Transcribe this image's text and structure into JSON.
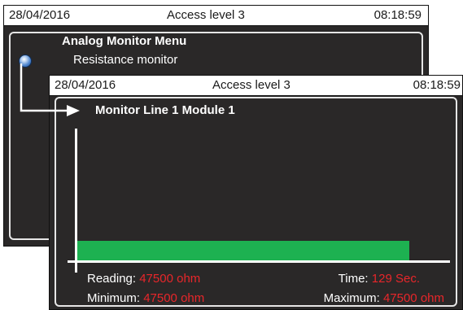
{
  "back_screen": {
    "status": {
      "date": "28/04/2016",
      "access": "Access level 3",
      "time": "08:18:59"
    },
    "menu_title": "Analog Monitor Menu",
    "menu_item": "Resistance monitor",
    "bullet_icon": "radio-bullet-icon"
  },
  "front_screen": {
    "status": {
      "date": "28/04/2016",
      "access": "Access level 3",
      "time": "08:18:59"
    },
    "title": "Monitor Line 1 Module 1",
    "arrow_icon": "arrow-right-icon",
    "level_fraction": 0.835,
    "bar_color": "#1db151",
    "readouts": {
      "reading_label": "Reading:",
      "reading_value": "47500 ohm",
      "time_label": "Time:",
      "time_value": "129 Sec.",
      "minimum_label": "Minimum:",
      "minimum_value": "47500 ohm",
      "maximum_label": "Maximum:",
      "maximum_value": "47500 ohm"
    },
    "value_color": "#e8262a"
  }
}
